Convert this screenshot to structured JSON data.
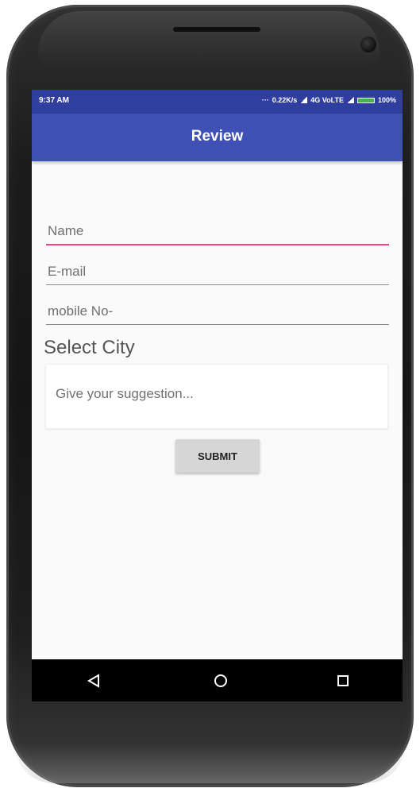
{
  "status_bar": {
    "time": "9:37 AM",
    "dots": "···",
    "network_speed": "0.22K/s",
    "network": "4G VoLTE",
    "battery": "100%"
  },
  "app_bar": {
    "title": "Review"
  },
  "form": {
    "name_placeholder": "Name",
    "email_placeholder": "E-mail",
    "mobile_placeholder": "mobile No-",
    "city_label": "Select City",
    "suggestion_placeholder": "Give your suggestion...",
    "submit_label": "SUBMIT"
  },
  "nav_bar": {
    "back_icon": "back-triangle-icon",
    "home_icon": "home-circle-icon",
    "recent_icon": "recent-square-icon"
  },
  "colors": {
    "status_bar": "#303f9f",
    "app_bar": "#3f51b5",
    "accent": "#ff4081",
    "battery": "#4caf50"
  }
}
